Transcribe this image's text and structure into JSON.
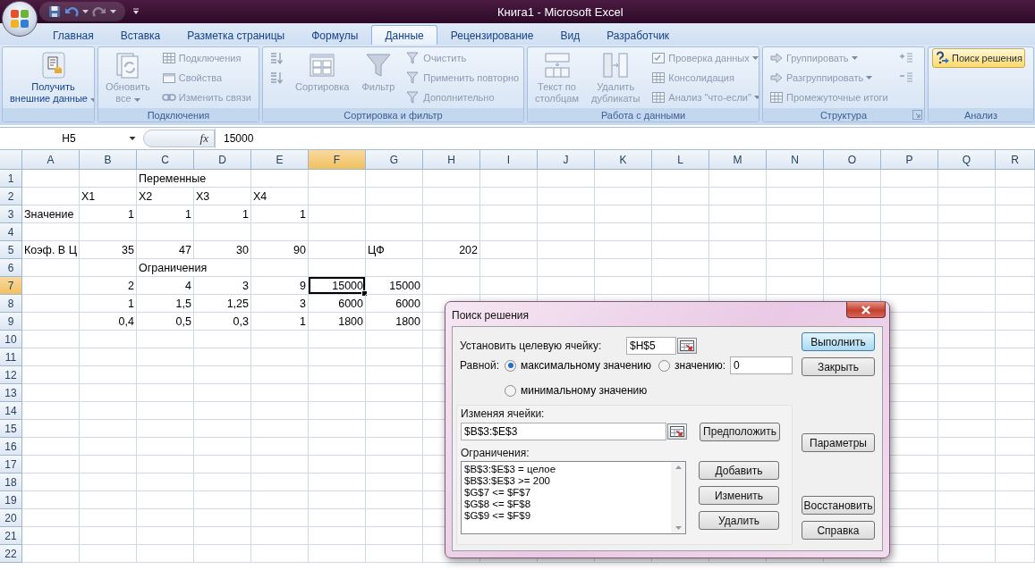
{
  "window": {
    "title": "Книга1 - Microsoft Excel"
  },
  "tabs": [
    {
      "label": "Главная",
      "selected": false
    },
    {
      "label": "Вставка",
      "selected": false
    },
    {
      "label": "Разметка страницы",
      "selected": false
    },
    {
      "label": "Формулы",
      "selected": false
    },
    {
      "label": "Данные",
      "selected": true
    },
    {
      "label": "Рецензирование",
      "selected": false
    },
    {
      "label": "Вид",
      "selected": false
    },
    {
      "label": "Разработчик",
      "selected": false
    }
  ],
  "ribbon": {
    "groups": [
      {
        "launcher": false,
        "items": [
          {
            "kind": "large",
            "lines": [
              "Получить",
              "внешние данные"
            ],
            "disabled": false,
            "highlighted": false,
            "menu": true
          }
        ]
      },
      {
        "title": "Подключения",
        "launcher": false,
        "items": [
          {
            "kind": "large",
            "lines": [
              "Обновить",
              "все"
            ],
            "disabled": true,
            "highlighted": false,
            "menu": true
          },
          {
            "kind": "small",
            "label": "Подключения",
            "disabled": true,
            "highlighted": false,
            "menu": false
          },
          {
            "kind": "small",
            "label": "Свойства",
            "disabled": true,
            "highlighted": false,
            "menu": false
          },
          {
            "kind": "small",
            "label": "Изменить связи",
            "disabled": true,
            "highlighted": false,
            "menu": false
          }
        ]
      },
      {
        "title": "Сортировка и фильтр",
        "launcher": false,
        "items": [
          {
            "kind": "icon",
            "disabled": true,
            "highlighted": false,
            "menu": false
          },
          {
            "kind": "icon",
            "disabled": true,
            "highlighted": false,
            "menu": false
          },
          {
            "kind": "large",
            "lines": [
              "Сортировка"
            ],
            "disabled": true,
            "highlighted": false,
            "menu": false
          },
          {
            "kind": "large",
            "lines": [
              "Фильтр"
            ],
            "disabled": true,
            "highlighted": false,
            "menu": false
          },
          {
            "kind": "small",
            "label": "Очистить",
            "disabled": true,
            "highlighted": false,
            "menu": false
          },
          {
            "kind": "small",
            "label": "Применить повторно",
            "disabled": true,
            "highlighted": false,
            "menu": false
          },
          {
            "kind": "small",
            "label": "Дополнительно",
            "disabled": true,
            "highlighted": false,
            "menu": false
          }
        ]
      },
      {
        "title": "Работа с данными",
        "launcher": false,
        "items": [
          {
            "kind": "large",
            "lines": [
              "Текст по",
              "столбцам"
            ],
            "disabled": true,
            "highlighted": false,
            "menu": false
          },
          {
            "kind": "large",
            "lines": [
              "Удалить",
              "дубликаты"
            ],
            "disabled": true,
            "highlighted": false,
            "menu": false
          },
          {
            "kind": "small",
            "label": "Проверка данных",
            "disabled": true,
            "highlighted": false,
            "menu": true
          },
          {
            "kind": "small",
            "label": "Консолидация",
            "disabled": true,
            "highlighted": false,
            "menu": false
          },
          {
            "kind": "small",
            "label": "Анализ \"что-если\"",
            "disabled": true,
            "highlighted": false,
            "menu": true
          }
        ]
      },
      {
        "title": "Структура",
        "launcher": true,
        "items": [
          {
            "kind": "small",
            "label": "Группировать",
            "disabled": true,
            "highlighted": false,
            "menu": true
          },
          {
            "kind": "small",
            "label": "Разгруппировать",
            "disabled": true,
            "highlighted": false,
            "menu": true
          },
          {
            "kind": "small",
            "label": "Промежуточные итоги",
            "disabled": true,
            "highlighted": false,
            "menu": false
          },
          {
            "kind": "icon",
            "disabled": true,
            "highlighted": false,
            "menu": false
          },
          {
            "kind": "icon",
            "disabled": true,
            "highlighted": false,
            "menu": false
          }
        ]
      },
      {
        "title": "Анализ",
        "launcher": false,
        "items": [
          {
            "kind": "small",
            "label": "Поиск решения",
            "disabled": false,
            "highlighted": true,
            "menu": false
          }
        ]
      }
    ]
  },
  "formula_bar": {
    "name_box": "H5",
    "insert_function": "fx",
    "value": "15000"
  },
  "sheet": {
    "columns": [
      {
        "label": "A",
        "selected": false
      },
      {
        "label": "B",
        "selected": false
      },
      {
        "label": "C",
        "selected": false
      },
      {
        "label": "D",
        "selected": false
      },
      {
        "label": "E",
        "selected": false
      },
      {
        "label": "F",
        "selected": true
      },
      {
        "label": "G",
        "selected": false
      },
      {
        "label": "H",
        "selected": false
      },
      {
        "label": "I",
        "selected": false
      },
      {
        "label": "J",
        "selected": false
      },
      {
        "label": "K",
        "selected": false
      },
      {
        "label": "L",
        "selected": false
      },
      {
        "label": "M",
        "selected": false
      },
      {
        "label": "N",
        "selected": false
      },
      {
        "label": "O",
        "selected": false
      },
      {
        "label": "P",
        "selected": false
      },
      {
        "label": "Q",
        "selected": false
      },
      {
        "label": "R",
        "selected": false
      }
    ],
    "rows": [
      {
        "number": "1",
        "selected": false,
        "cells": [
          {
            "kind": "empty",
            "selected": false
          },
          {
            "kind": "empty",
            "selected": false
          },
          {
            "kind": "text",
            "text": "Переменные",
            "selected": false
          }
        ]
      },
      {
        "number": "2",
        "selected": false,
        "cells": [
          {
            "kind": "empty",
            "selected": false
          },
          {
            "kind": "text",
            "text": "X1",
            "selected": false
          },
          {
            "kind": "text",
            "text": "X2",
            "selected": false
          },
          {
            "kind": "text",
            "text": "X3",
            "selected": false
          },
          {
            "kind": "text",
            "text": "X4",
            "selected": false
          }
        ]
      },
      {
        "number": "3",
        "selected": false,
        "cells": [
          {
            "kind": "text",
            "text": "Значение",
            "selected": false
          },
          {
            "kind": "number",
            "text": "1",
            "selected": false
          },
          {
            "kind": "number",
            "text": "1",
            "selected": false
          },
          {
            "kind": "number",
            "text": "1",
            "selected": false
          },
          {
            "kind": "number",
            "text": "1",
            "selected": false
          }
        ]
      },
      {
        "number": "4",
        "selected": false
      },
      {
        "number": "5",
        "selected": false,
        "cells": [
          {
            "kind": "text",
            "text": "Коэф. В Ц",
            "selected": false
          },
          {
            "kind": "number",
            "text": "35",
            "selected": false
          },
          {
            "kind": "number",
            "text": "47",
            "selected": false
          },
          {
            "kind": "number",
            "text": "30",
            "selected": false
          },
          {
            "kind": "number",
            "text": "90",
            "selected": false
          },
          {
            "kind": "empty",
            "selected": false
          },
          {
            "kind": "text",
            "text": "ЦФ",
            "selected": false
          },
          {
            "kind": "number",
            "text": "202",
            "selected": false
          }
        ]
      },
      {
        "number": "6",
        "selected": false,
        "cells": [
          {
            "kind": "empty",
            "selected": false
          },
          {
            "kind": "empty",
            "selected": false
          },
          {
            "kind": "text",
            "text": "Ограничения",
            "selected": false
          }
        ]
      },
      {
        "number": "7",
        "selected": true,
        "cells": [
          {
            "kind": "empty",
            "selected": false
          },
          {
            "kind": "number",
            "text": "2",
            "selected": false
          },
          {
            "kind": "number",
            "text": "4",
            "selected": false
          },
          {
            "kind": "number",
            "text": "3",
            "selected": false
          },
          {
            "kind": "number",
            "text": "9",
            "selected": false
          },
          {
            "kind": "number",
            "text": "15000",
            "selected": true
          },
          {
            "kind": "number",
            "text": "15000",
            "selected": false
          }
        ]
      },
      {
        "number": "8",
        "selected": false,
        "cells": [
          {
            "kind": "empty",
            "selected": false
          },
          {
            "kind": "number",
            "text": "1",
            "selected": false
          },
          {
            "kind": "number",
            "text": "1,5",
            "selected": false
          },
          {
            "kind": "number",
            "text": "1,25",
            "selected": false
          },
          {
            "kind": "number",
            "text": "3",
            "selected": false
          },
          {
            "kind": "number",
            "text": "6000",
            "selected": false
          },
          {
            "kind": "number",
            "text": "6000",
            "selected": false
          }
        ]
      },
      {
        "number": "9",
        "selected": false,
        "cells": [
          {
            "kind": "empty",
            "selected": false
          },
          {
            "kind": "number",
            "text": "0,4",
            "selected": false
          },
          {
            "kind": "number",
            "text": "0,5",
            "selected": false
          },
          {
            "kind": "number",
            "text": "0,3",
            "selected": false
          },
          {
            "kind": "number",
            "text": "1",
            "selected": false
          },
          {
            "kind": "number",
            "text": "1800",
            "selected": false
          },
          {
            "kind": "number",
            "text": "1800",
            "selected": false
          }
        ]
      },
      {
        "number": "10",
        "selected": false
      },
      {
        "number": "11",
        "selected": false
      },
      {
        "number": "12",
        "selected": false
      },
      {
        "number": "13",
        "selected": false
      },
      {
        "number": "14",
        "selected": false
      },
      {
        "number": "15",
        "selected": false
      },
      {
        "number": "16",
        "selected": false
      },
      {
        "number": "17",
        "selected": false
      },
      {
        "number": "18",
        "selected": false
      },
      {
        "number": "19",
        "selected": false
      },
      {
        "number": "20",
        "selected": false
      },
      {
        "number": "21",
        "selected": false
      },
      {
        "number": "22",
        "selected": false
      }
    ]
  },
  "dialog": {
    "title": "Поиск решения",
    "target_label": "Установить целевую ячейку:",
    "target_value": "$H$5",
    "equal_label": "Равной:",
    "options": [
      {
        "label": "максимальному значению",
        "selected": true
      },
      {
        "label": "значению:",
        "selected": false
      },
      {
        "label": "минимальному значению",
        "selected": false
      }
    ],
    "value": "0",
    "changing_label": "Изменяя ячейки:",
    "changing_value": "$B$3:$E$3",
    "guess_button": "Предположить",
    "constraints_label": "Ограничения:",
    "constraints": [
      "$B$3:$E$3 = целое",
      "$B$3:$E$3 >= 200",
      "$G$7 <= $F$7",
      "$G$8 <= $F$8",
      "$G$9 <= $F$9"
    ],
    "constraint_buttons": [
      "Добавить",
      "Изменить",
      "Удалить"
    ],
    "side_buttons": [
      {
        "label": "Выполнить",
        "selected": true
      },
      {
        "label": "Закрыть",
        "selected": false
      },
      {
        "label": "Параметры",
        "selected": false
      },
      {
        "label": "Восстановить",
        "selected": false
      },
      {
        "label": "Справка",
        "selected": false
      }
    ]
  }
}
